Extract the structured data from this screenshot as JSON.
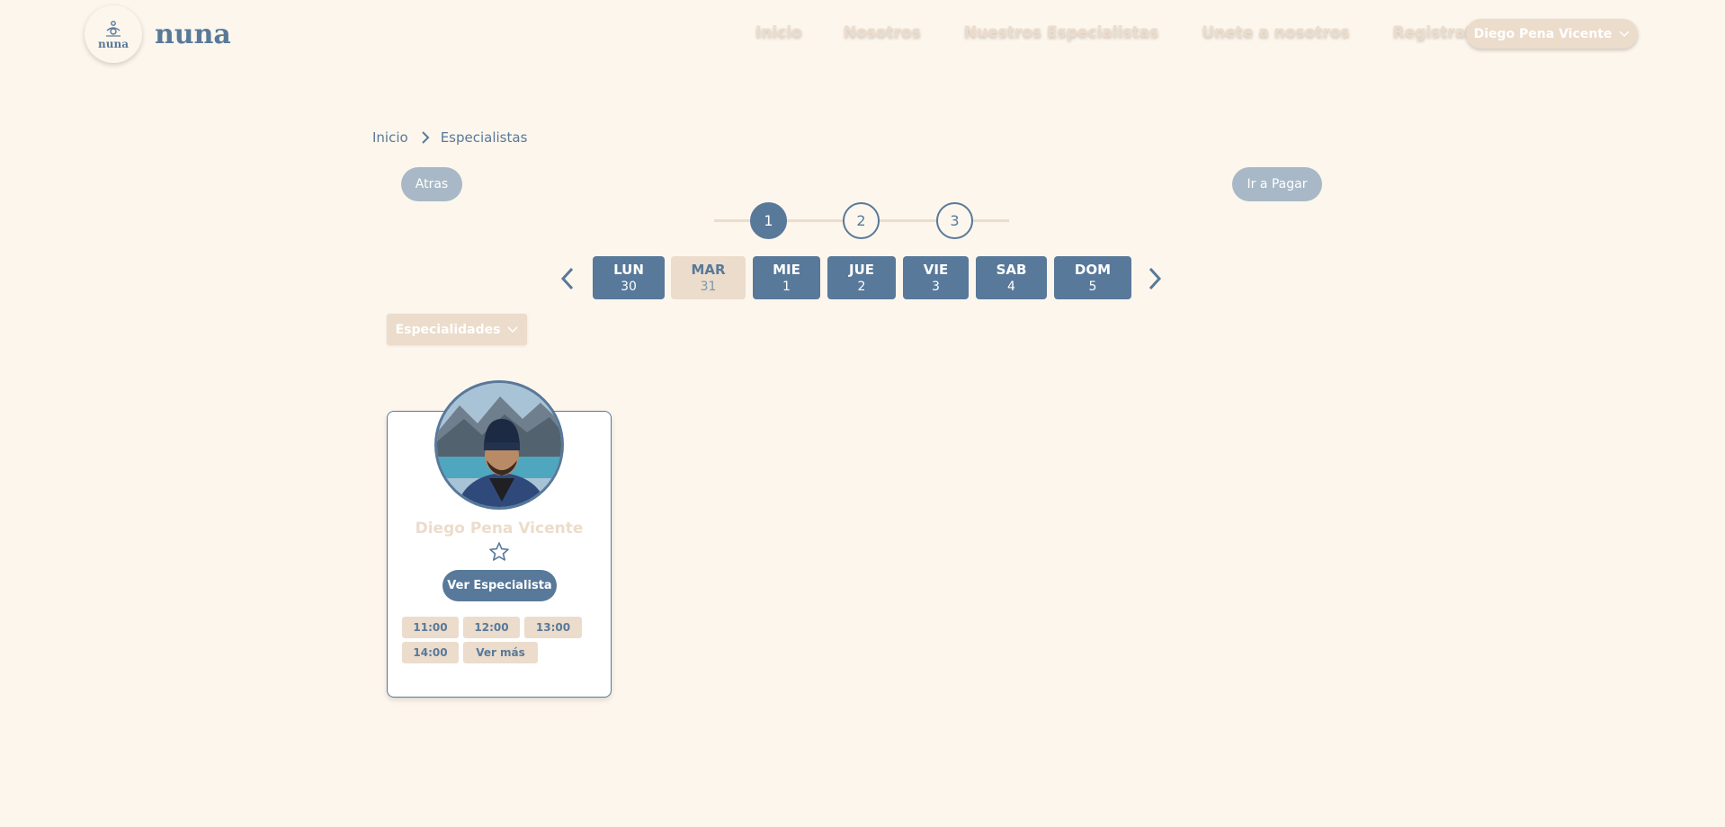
{
  "brand": {
    "logo_small": "nuna",
    "name": "nuna"
  },
  "nav": {
    "items": [
      "Inicio",
      "Nosotros",
      "Nuestros Especialistas",
      "Unete a nosotros",
      "Registrate"
    ],
    "user_label": "Diego Pena Vicente"
  },
  "breadcrumb": {
    "home": "Inicio",
    "current": "Especialistas"
  },
  "actions": {
    "back": "Atras",
    "pay": "Ir a Pagar"
  },
  "stepper": {
    "steps": [
      "1",
      "2",
      "3"
    ],
    "active_step": 1
  },
  "days": [
    {
      "name": "LUN",
      "num": "30"
    },
    {
      "name": "MAR",
      "num": "31",
      "selected": true
    },
    {
      "name": "MIE",
      "num": "1"
    },
    {
      "name": "JUE",
      "num": "2"
    },
    {
      "name": "VIE",
      "num": "3"
    },
    {
      "name": "SAB",
      "num": "4"
    },
    {
      "name": "DOM",
      "num": "5"
    }
  ],
  "filters": {
    "specialties": "Especialidades"
  },
  "specialist": {
    "name": "Diego Pena Vicente",
    "view_button": "Ver Especialista",
    "slots": [
      "11:00",
      "12:00",
      "13:00",
      "14:00",
      "Ver más"
    ]
  },
  "colors": {
    "background": "#fdf6ec",
    "primary": "#58799a",
    "beige": "#ecdccb",
    "muted_button": "#a8b8c6"
  }
}
